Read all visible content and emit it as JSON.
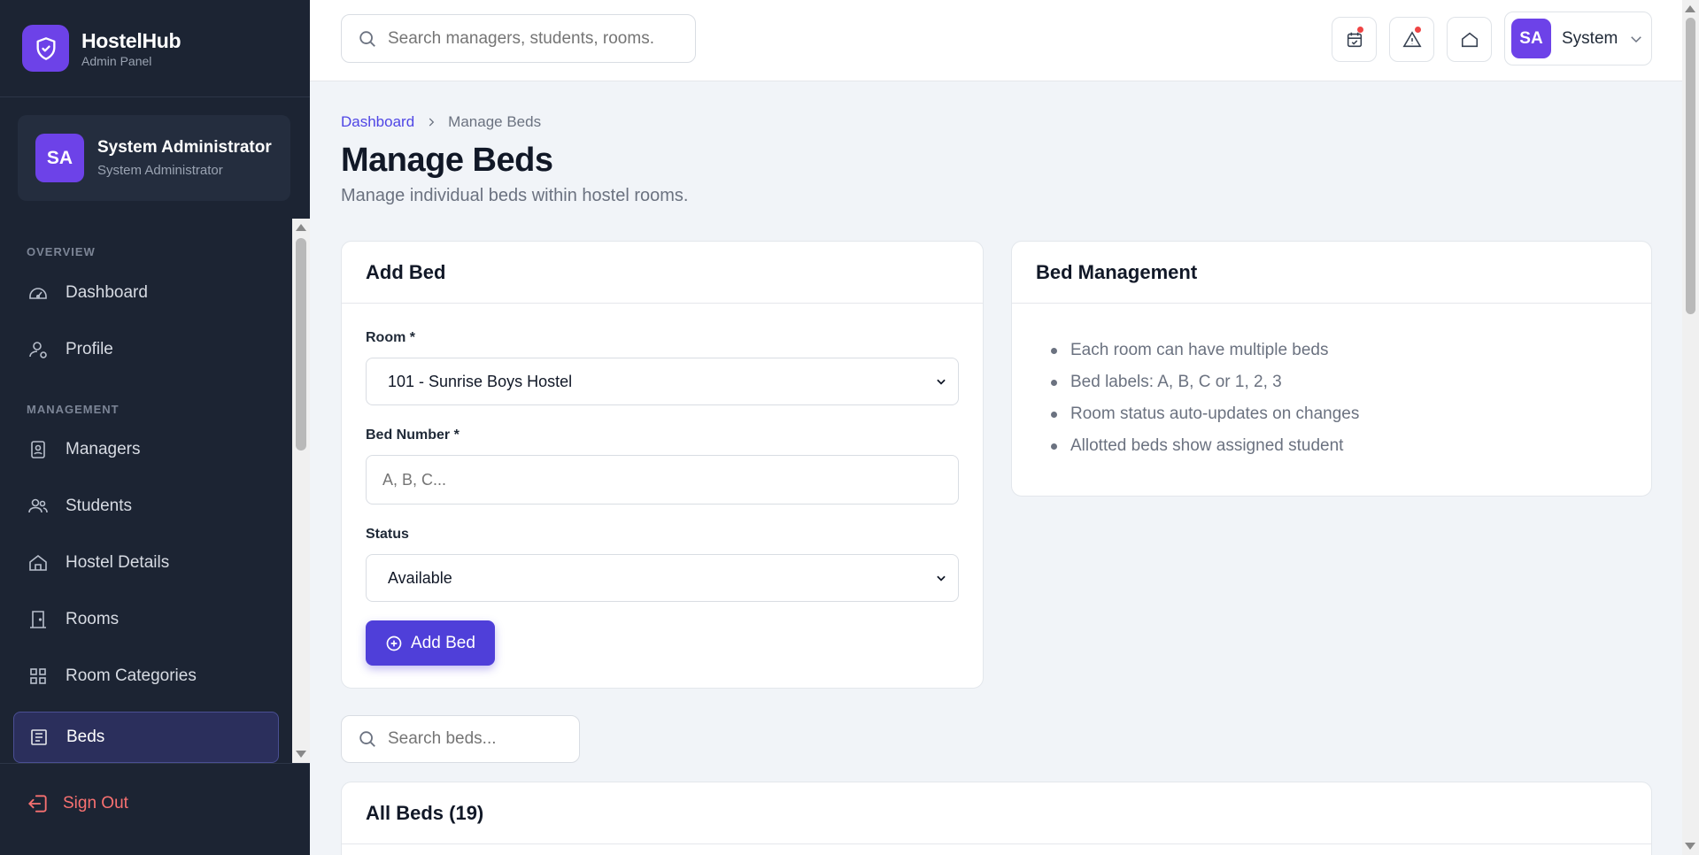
{
  "brand": {
    "name": "HostelHub",
    "subtitle": "Admin Panel"
  },
  "user": {
    "initials": "SA",
    "name": "System Administrator",
    "role": "System Administrator"
  },
  "sidebar": {
    "sections": [
      {
        "title": "OVERVIEW"
      },
      {
        "title": "MANAGEMENT"
      }
    ],
    "items": [
      {
        "label": "Dashboard",
        "icon": "dashboard-gauge-icon"
      },
      {
        "label": "Profile",
        "icon": "user-profile-icon"
      },
      {
        "label": "Managers",
        "icon": "id-badge-icon"
      },
      {
        "label": "Students",
        "icon": "users-icon"
      },
      {
        "label": "Hostel Details",
        "icon": "home-icon"
      },
      {
        "label": "Rooms",
        "icon": "door-icon"
      },
      {
        "label": "Room Categories",
        "icon": "grid-icon"
      },
      {
        "label": "Beds",
        "icon": "list-icon",
        "active": true
      }
    ],
    "signout": "Sign Out"
  },
  "topbar": {
    "search_placeholder": "Search managers, students, rooms...",
    "user_initials": "SA",
    "user_name": "System"
  },
  "breadcrumb": {
    "root": "Dashboard",
    "current": "Manage Beds"
  },
  "page": {
    "title": "Manage Beds",
    "subtitle": "Manage individual beds within hostel rooms."
  },
  "add_bed": {
    "title": "Add Bed",
    "room_label": "Room *",
    "room_value": "101 - Sunrise Boys Hostel",
    "bed_number_label": "Bed Number *",
    "bed_number_placeholder": "A, B, C...",
    "status_label": "Status",
    "status_value": "Available",
    "submit_label": "Add Bed"
  },
  "bed_management": {
    "title": "Bed Management",
    "items": [
      "Each room can have multiple beds",
      "Bed labels: A, B, C or 1, 2, 3",
      "Room status auto-updates on changes",
      "Allotted beds show assigned student"
    ]
  },
  "bed_search": {
    "placeholder": "Search beds..."
  },
  "all_beds": {
    "title": "All Beds (19)"
  },
  "colors": {
    "accent": "#4f3fd9",
    "sidebar_bg": "#1c2433",
    "danger": "#f87171"
  }
}
